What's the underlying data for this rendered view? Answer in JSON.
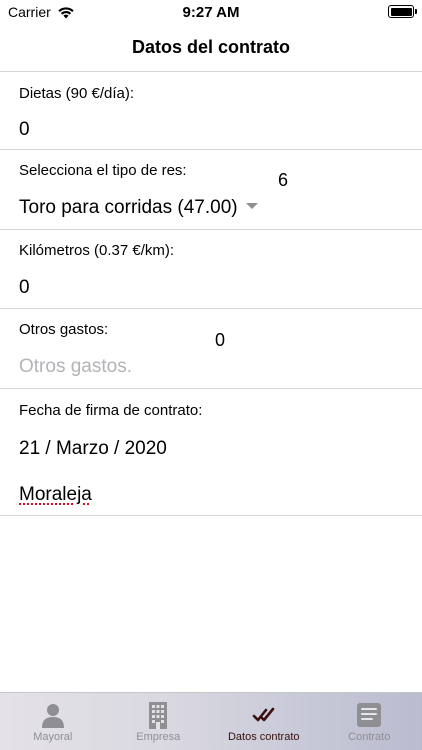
{
  "status_bar": {
    "carrier": "Carrier",
    "time": "9:27 AM"
  },
  "nav": {
    "title": "Datos del contrato"
  },
  "form": {
    "dietas": {
      "label": "Dietas (90 €/día):",
      "value": "0"
    },
    "tipo_res": {
      "label": "Selecciona el tipo de res:",
      "value": "Toro para corridas (47.00)",
      "side_value": "6"
    },
    "kilometros": {
      "label": "Kilómetros (0.37 €/km):",
      "value": "0"
    },
    "otros_gastos": {
      "label": "Otros gastos:",
      "placeholder": "Otros gastos.",
      "side_value": "0"
    },
    "fecha": {
      "label": "Fecha de firma de contrato:",
      "date": "21 / Marzo / 2020",
      "place": "Moraleja"
    }
  },
  "tabs": [
    {
      "label": "Mayoral",
      "icon": "person-icon",
      "active": false
    },
    {
      "label": "Empresa",
      "icon": "building-icon",
      "active": false
    },
    {
      "label": "Datos contrato",
      "icon": "checkmarks-icon",
      "active": true
    },
    {
      "label": "Contrato",
      "icon": "document-icon",
      "active": false
    }
  ],
  "colors": {
    "active_tab": "#3a0f0f",
    "inactive_tab": "#8e8e93",
    "separator": "#d6d6d6",
    "placeholder": "#b3b3b8"
  }
}
